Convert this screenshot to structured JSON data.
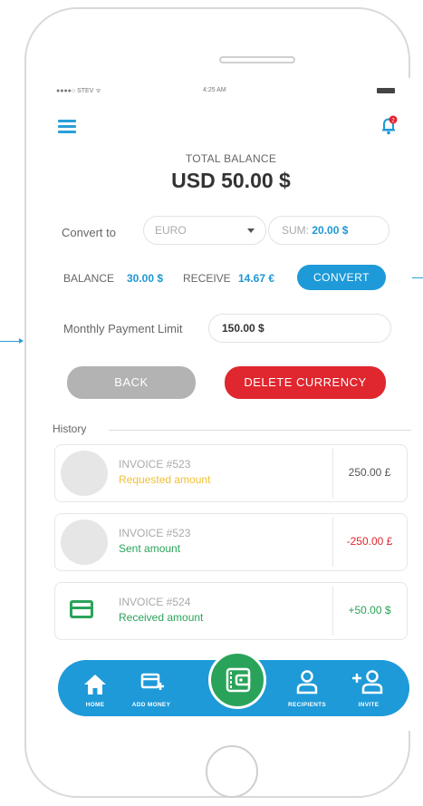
{
  "status_bar": {
    "carrier": "●●●●○ STEV ᯤ",
    "time": "4:25 AM"
  },
  "balance": {
    "label": "TOTAL BALANCE",
    "value": "USD 50.00 $"
  },
  "convert": {
    "label": "Convert to",
    "currency": "EURO",
    "sum_label": "SUM:",
    "sum_value": "20.00 $",
    "balance_label": "BALANCE",
    "balance_value": "30.00 $",
    "receive_label": "RECEIVE",
    "receive_value": "14.67 €",
    "convert_button": "CONVERT"
  },
  "limit": {
    "label": "Monthly Payment Limit",
    "value": "150.00 $"
  },
  "actions": {
    "back": "BACK",
    "delete": "DELETE CURRENCY"
  },
  "history": {
    "title": "History",
    "items": [
      {
        "invoice": "INVOICE #523",
        "subtitle": "Requested amount",
        "amount": "250.00 £",
        "subtitle_color": "#f2c037",
        "amount_color": "#555555"
      },
      {
        "invoice": "INVOICE #523",
        "subtitle": "Sent amount",
        "amount": "-250.00 £",
        "subtitle_color": "#2aa35a",
        "amount_color": "#e0262e"
      },
      {
        "invoice": "INVOICE #524",
        "subtitle": "Received amount",
        "amount": "+50.00 $",
        "subtitle_color": "#2aa35a",
        "amount_color": "#2aa35a"
      }
    ]
  },
  "nav": {
    "home": "HOME",
    "add_money": "ADD MONEY",
    "recipients": "RECIPIENTS",
    "invite": "INVITE"
  },
  "colors": {
    "accent": "#1e9ad8",
    "danger": "#e0262e",
    "success": "#2aa35a",
    "muted_button": "#b3b3b3"
  }
}
